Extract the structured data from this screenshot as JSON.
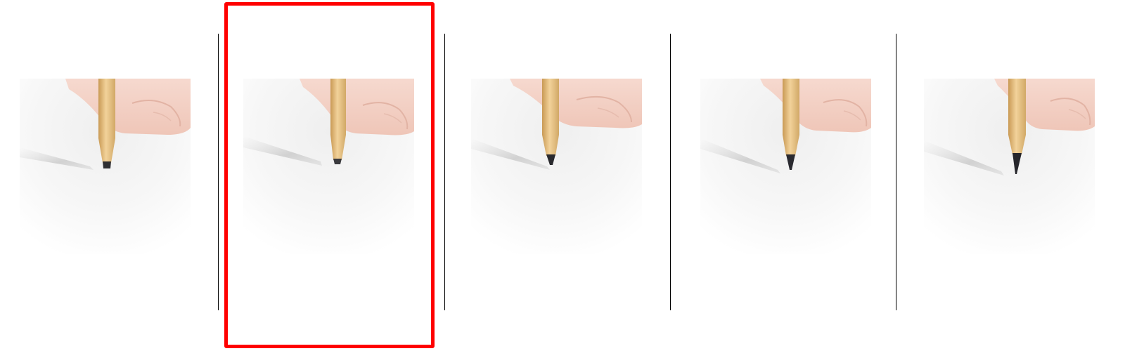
{
  "gallery": {
    "selected_index": 1,
    "selection_color": "#ff0000",
    "divider_color": "#000000",
    "options": [
      {
        "id": "option-1",
        "tip_style": "blunt-broken",
        "icon": "pencil-photo"
      },
      {
        "id": "option-2",
        "tip_style": "dull-rounded",
        "icon": "pencil-photo"
      },
      {
        "id": "option-3",
        "tip_style": "short-blunt",
        "icon": "pencil-photo"
      },
      {
        "id": "option-4",
        "tip_style": "sharp",
        "icon": "pencil-photo"
      },
      {
        "id": "option-5",
        "tip_style": "very-sharp",
        "icon": "pencil-photo"
      }
    ]
  }
}
